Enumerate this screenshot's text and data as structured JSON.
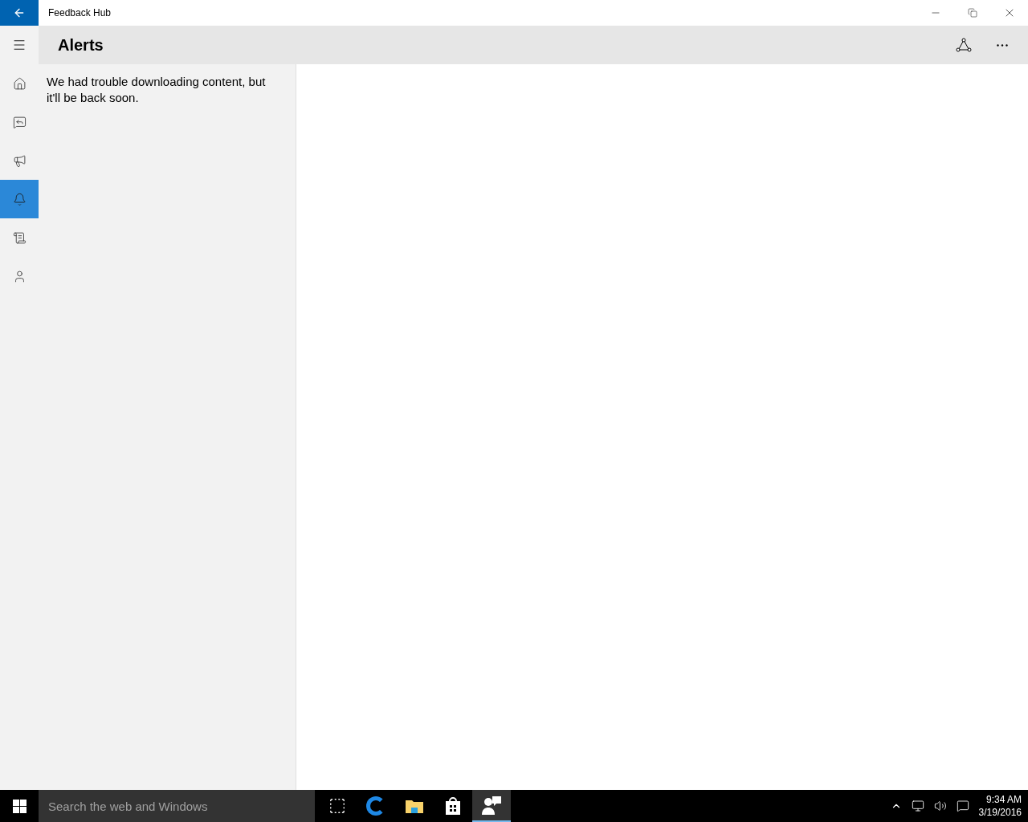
{
  "window": {
    "title": "Feedback Hub"
  },
  "header": {
    "title": "Alerts"
  },
  "nav": [
    {
      "kind": "home",
      "selected": false
    },
    {
      "kind": "feedback",
      "selected": false
    },
    {
      "kind": "announcements",
      "selected": false
    },
    {
      "kind": "alerts",
      "selected": true
    },
    {
      "kind": "quests",
      "selected": false
    },
    {
      "kind": "profile",
      "selected": false
    }
  ],
  "message": "We had trouble downloading content, but it'll be back soon.",
  "taskbar": {
    "search": {
      "placeholder": "Search the web and Windows"
    },
    "apps": [
      {
        "kind": "taskview",
        "selected": false
      },
      {
        "kind": "edge",
        "selected": false
      },
      {
        "kind": "explorer",
        "selected": false
      },
      {
        "kind": "store",
        "selected": false
      },
      {
        "kind": "feedback",
        "selected": true
      }
    ],
    "time": "9:34 AM",
    "date": "3/19/2016"
  }
}
